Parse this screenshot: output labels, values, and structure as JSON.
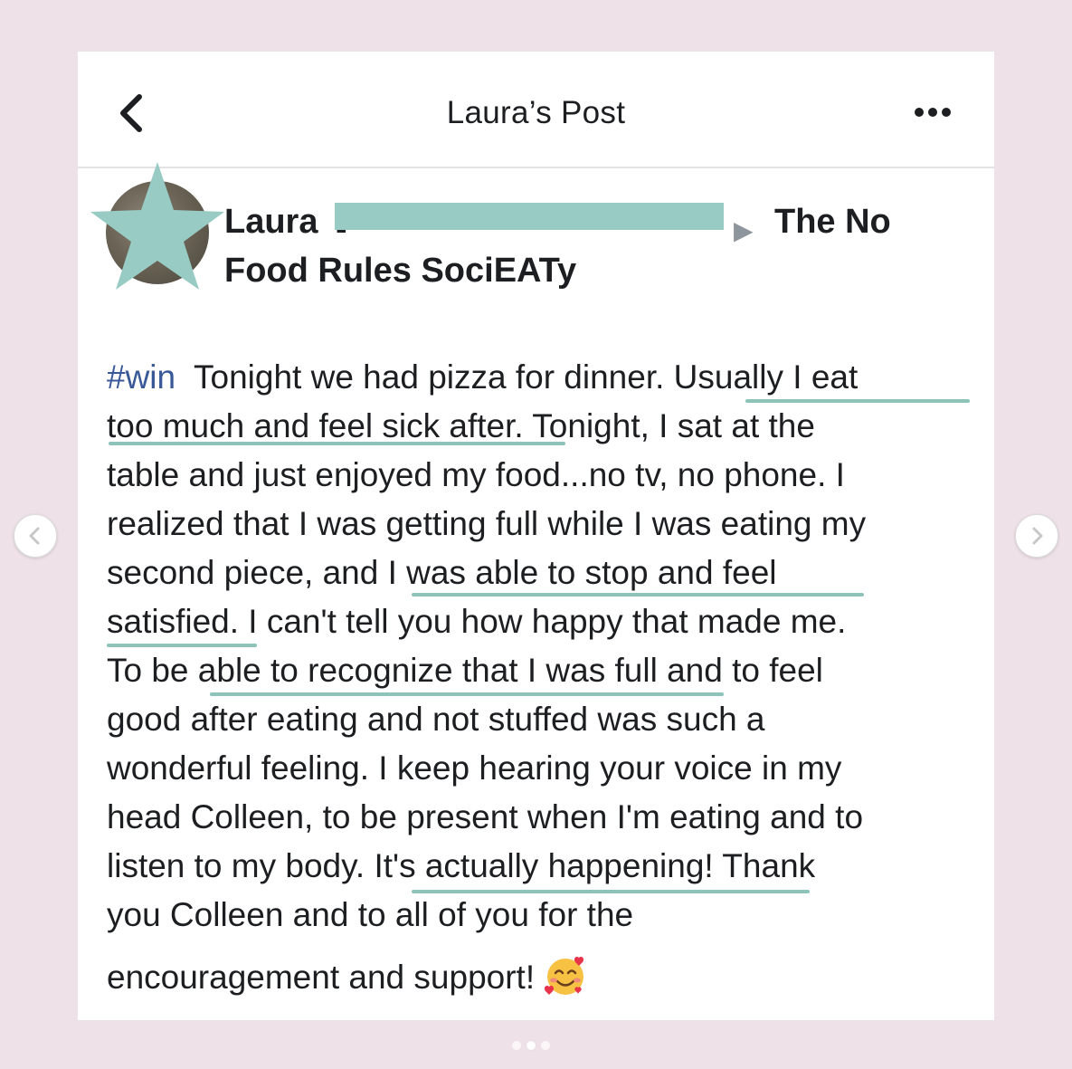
{
  "header": {
    "title": "Laura’s Post",
    "back_icon": "chevron-left-icon",
    "more_icon": "ellipsis-icon"
  },
  "post": {
    "author_first": "Laura",
    "author_initial": "L",
    "target_group_line1": "The No",
    "target_group_line2": "Food Rules SociEATy",
    "hashtag": "#win",
    "lines": [
      "Tonight we had pizza for dinner.  Usually I eat",
      "too much and feel sick after.  Tonight, I sat at the",
      "table and just enjoyed my food...no tv, no phone.  I",
      "realized that I was getting full while I was eating my",
      "second piece, and I was able to stop and feel",
      "satisfied.  I can't tell you how happy that made me.",
      "To be able to recognize that I was full and to feel",
      "good after eating and not stuffed was such a",
      "wonderful feeling.  I keep hearing your voice in my",
      "head Colleen, to be present when I'm eating and to",
      "listen to my body.  It's actually happening!  Thank",
      "you Colleen and to all of you for the",
      "encouragement and support!"
    ],
    "emoji": "smiling-face-with-hearts"
  },
  "carousel": {
    "prev_icon": "chevron-left-icon",
    "next_icon": "chevron-right-icon",
    "slide_count": 3,
    "active_slide": 2
  },
  "colors": {
    "background": "#efe1e8",
    "highlight": "#8ec3ba",
    "redaction": "#98cbc3",
    "hashtag": "#385898"
  }
}
